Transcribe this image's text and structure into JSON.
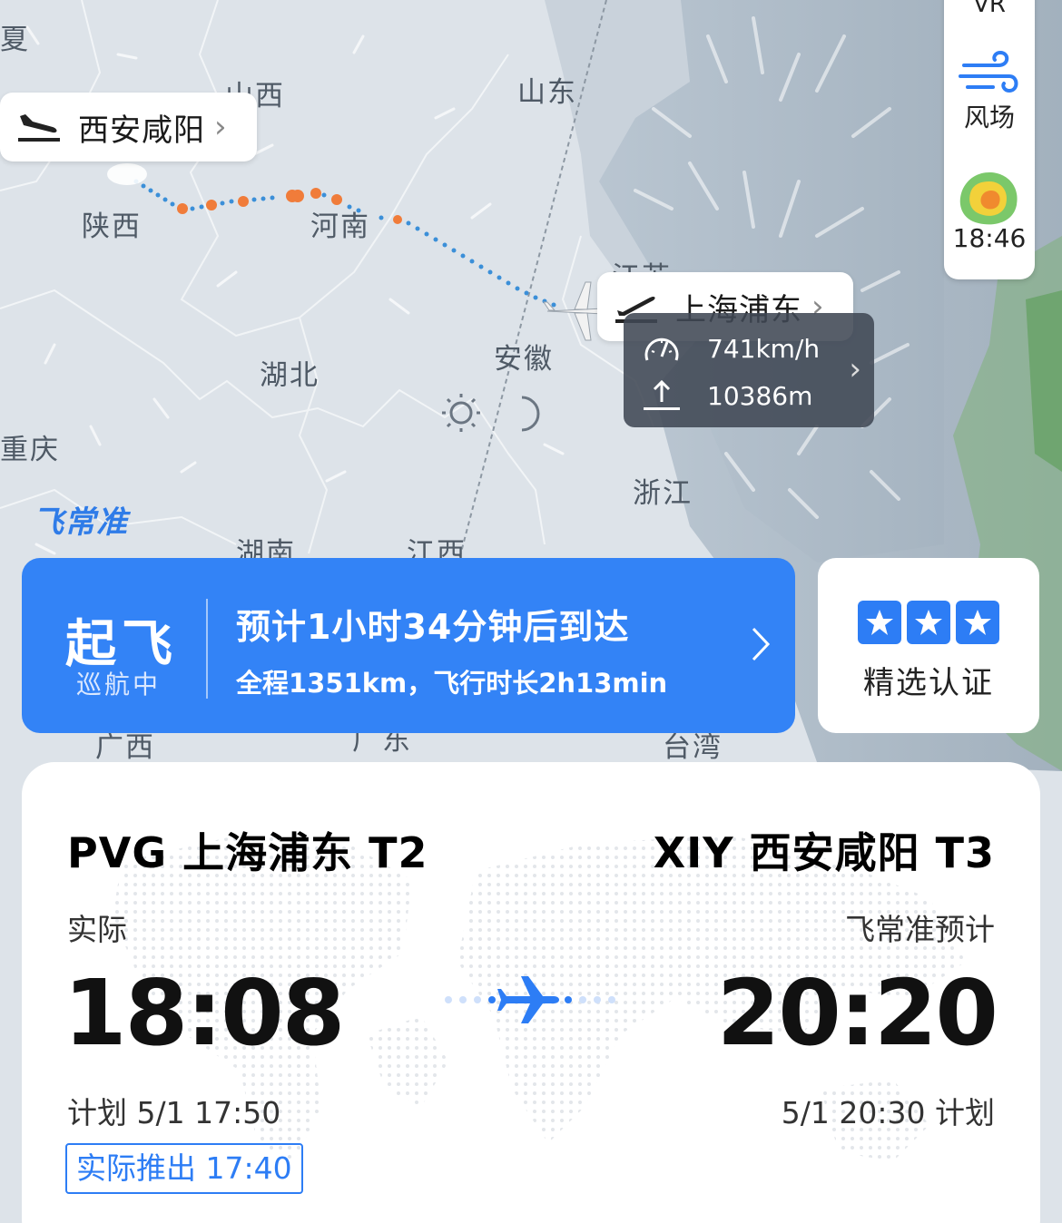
{
  "map": {
    "provinces": {
      "xia": "夏",
      "shanxi": "山西",
      "shandong": "山东",
      "shaanxi": "陕西",
      "henan": "河南",
      "jiangsu": "江苏",
      "hubei": "湖北",
      "anhui": "安徽",
      "shanghai": "上",
      "chongqing": "重庆",
      "zhejiang": "浙江",
      "hunan": "湖南",
      "jiangxi": "江西",
      "guangxi": "广西",
      "guangdong": "广东",
      "taiwan": "台湾"
    },
    "departure_bubble": "西安咸阳",
    "arrival_bubble": "上海浦东",
    "speed": "741km/h",
    "altitude": "10386m",
    "brand": "飞常准"
  },
  "tools": {
    "vr_label": "VR",
    "wind_label": "风场",
    "radar_time": "18:46"
  },
  "status": {
    "main": "起飞",
    "sub": "巡航中",
    "eta": "预计1小时34分钟后到达",
    "distance": "全程1351km，飞行时长2h13min"
  },
  "cert": {
    "label": "精选认证",
    "stars": 3
  },
  "flight": {
    "departure": {
      "name": "PVG 上海浦东 T2",
      "kind": "实际",
      "time": "18:08",
      "plan": "计划 5/1 17:50",
      "pushback": "实际推出 17:40"
    },
    "arrival": {
      "name": "XIY 西安咸阳 T3",
      "kind": "飞常准预计",
      "time": "20:20",
      "plan": "5/1 20:30 计划"
    }
  },
  "colors": {
    "accent": "#3383f6",
    "track_orange": "#f07c3a",
    "track_blue": "#3b8fd8"
  }
}
